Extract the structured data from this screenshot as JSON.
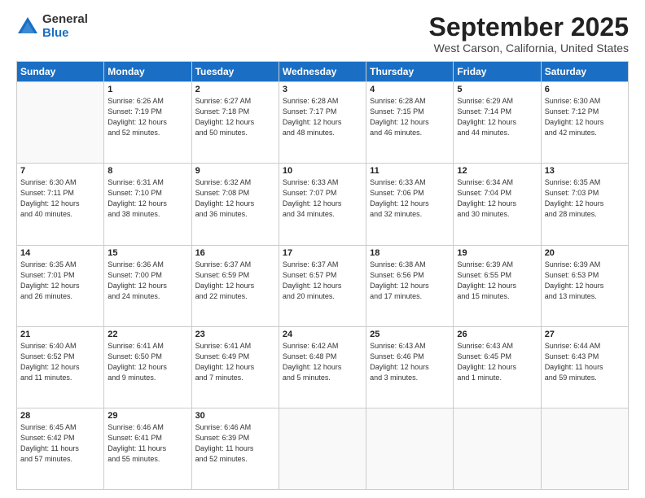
{
  "logo": {
    "general": "General",
    "blue": "Blue"
  },
  "title": "September 2025",
  "subtitle": "West Carson, California, United States",
  "days_header": [
    "Sunday",
    "Monday",
    "Tuesday",
    "Wednesday",
    "Thursday",
    "Friday",
    "Saturday"
  ],
  "weeks": [
    [
      {
        "day": "",
        "info": ""
      },
      {
        "day": "1",
        "info": "Sunrise: 6:26 AM\nSunset: 7:19 PM\nDaylight: 12 hours\nand 52 minutes."
      },
      {
        "day": "2",
        "info": "Sunrise: 6:27 AM\nSunset: 7:18 PM\nDaylight: 12 hours\nand 50 minutes."
      },
      {
        "day": "3",
        "info": "Sunrise: 6:28 AM\nSunset: 7:17 PM\nDaylight: 12 hours\nand 48 minutes."
      },
      {
        "day": "4",
        "info": "Sunrise: 6:28 AM\nSunset: 7:15 PM\nDaylight: 12 hours\nand 46 minutes."
      },
      {
        "day": "5",
        "info": "Sunrise: 6:29 AM\nSunset: 7:14 PM\nDaylight: 12 hours\nand 44 minutes."
      },
      {
        "day": "6",
        "info": "Sunrise: 6:30 AM\nSunset: 7:12 PM\nDaylight: 12 hours\nand 42 minutes."
      }
    ],
    [
      {
        "day": "7",
        "info": "Sunrise: 6:30 AM\nSunset: 7:11 PM\nDaylight: 12 hours\nand 40 minutes."
      },
      {
        "day": "8",
        "info": "Sunrise: 6:31 AM\nSunset: 7:10 PM\nDaylight: 12 hours\nand 38 minutes."
      },
      {
        "day": "9",
        "info": "Sunrise: 6:32 AM\nSunset: 7:08 PM\nDaylight: 12 hours\nand 36 minutes."
      },
      {
        "day": "10",
        "info": "Sunrise: 6:33 AM\nSunset: 7:07 PM\nDaylight: 12 hours\nand 34 minutes."
      },
      {
        "day": "11",
        "info": "Sunrise: 6:33 AM\nSunset: 7:06 PM\nDaylight: 12 hours\nand 32 minutes."
      },
      {
        "day": "12",
        "info": "Sunrise: 6:34 AM\nSunset: 7:04 PM\nDaylight: 12 hours\nand 30 minutes."
      },
      {
        "day": "13",
        "info": "Sunrise: 6:35 AM\nSunset: 7:03 PM\nDaylight: 12 hours\nand 28 minutes."
      }
    ],
    [
      {
        "day": "14",
        "info": "Sunrise: 6:35 AM\nSunset: 7:01 PM\nDaylight: 12 hours\nand 26 minutes."
      },
      {
        "day": "15",
        "info": "Sunrise: 6:36 AM\nSunset: 7:00 PM\nDaylight: 12 hours\nand 24 minutes."
      },
      {
        "day": "16",
        "info": "Sunrise: 6:37 AM\nSunset: 6:59 PM\nDaylight: 12 hours\nand 22 minutes."
      },
      {
        "day": "17",
        "info": "Sunrise: 6:37 AM\nSunset: 6:57 PM\nDaylight: 12 hours\nand 20 minutes."
      },
      {
        "day": "18",
        "info": "Sunrise: 6:38 AM\nSunset: 6:56 PM\nDaylight: 12 hours\nand 17 minutes."
      },
      {
        "day": "19",
        "info": "Sunrise: 6:39 AM\nSunset: 6:55 PM\nDaylight: 12 hours\nand 15 minutes."
      },
      {
        "day": "20",
        "info": "Sunrise: 6:39 AM\nSunset: 6:53 PM\nDaylight: 12 hours\nand 13 minutes."
      }
    ],
    [
      {
        "day": "21",
        "info": "Sunrise: 6:40 AM\nSunset: 6:52 PM\nDaylight: 12 hours\nand 11 minutes."
      },
      {
        "day": "22",
        "info": "Sunrise: 6:41 AM\nSunset: 6:50 PM\nDaylight: 12 hours\nand 9 minutes."
      },
      {
        "day": "23",
        "info": "Sunrise: 6:41 AM\nSunset: 6:49 PM\nDaylight: 12 hours\nand 7 minutes."
      },
      {
        "day": "24",
        "info": "Sunrise: 6:42 AM\nSunset: 6:48 PM\nDaylight: 12 hours\nand 5 minutes."
      },
      {
        "day": "25",
        "info": "Sunrise: 6:43 AM\nSunset: 6:46 PM\nDaylight: 12 hours\nand 3 minutes."
      },
      {
        "day": "26",
        "info": "Sunrise: 6:43 AM\nSunset: 6:45 PM\nDaylight: 12 hours\nand 1 minute."
      },
      {
        "day": "27",
        "info": "Sunrise: 6:44 AM\nSunset: 6:43 PM\nDaylight: 11 hours\nand 59 minutes."
      }
    ],
    [
      {
        "day": "28",
        "info": "Sunrise: 6:45 AM\nSunset: 6:42 PM\nDaylight: 11 hours\nand 57 minutes."
      },
      {
        "day": "29",
        "info": "Sunrise: 6:46 AM\nSunset: 6:41 PM\nDaylight: 11 hours\nand 55 minutes."
      },
      {
        "day": "30",
        "info": "Sunrise: 6:46 AM\nSunset: 6:39 PM\nDaylight: 11 hours\nand 52 minutes."
      },
      {
        "day": "",
        "info": ""
      },
      {
        "day": "",
        "info": ""
      },
      {
        "day": "",
        "info": ""
      },
      {
        "day": "",
        "info": ""
      }
    ]
  ]
}
